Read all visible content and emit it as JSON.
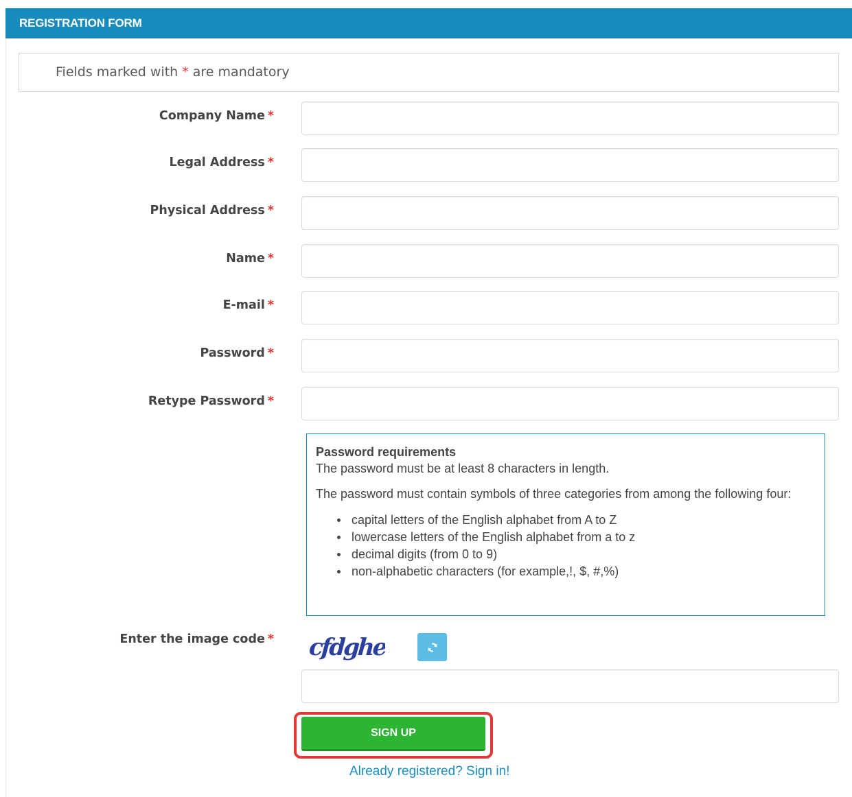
{
  "header": {
    "title": "REGISTRATION FORM"
  },
  "notice": {
    "prefix": "Fields marked with ",
    "star": "*",
    "suffix": " are mandatory"
  },
  "fields": [
    {
      "label": "Company Name",
      "value": ""
    },
    {
      "label": "Legal Address",
      "value": ""
    },
    {
      "label": "Physical Address",
      "value": ""
    },
    {
      "label": "Name",
      "value": ""
    },
    {
      "label": "E-mail",
      "value": ""
    },
    {
      "label": "Password",
      "value": ""
    },
    {
      "label": "Retype Password",
      "value": ""
    }
  ],
  "required_marker": "*",
  "password_requirements": {
    "title": "Password requirements",
    "length_rule": "The password must be at least 8 characters in length.",
    "categories_rule": "The password must contain symbols of three categories from among the following four:",
    "categories": [
      "capital letters of the English alphabet from A to Z",
      "lowercase letters of the English alphabet from a to z",
      "decimal digits (from 0 to 9)",
      "non-alphabetic characters (for example,!, $, #,%)"
    ]
  },
  "captcha": {
    "label": "Enter the image code",
    "code": "cfdghe",
    "refresh_icon": "refresh-icon",
    "value": ""
  },
  "actions": {
    "signup_label": "SIGN UP",
    "signin_link": "Already registered? Sign in!"
  },
  "colors": {
    "header_bg": "#188bbd",
    "signup_bg": "#2bb533",
    "highlight": "#e03a35",
    "required": "#e3342f",
    "link": "#1a8fc3",
    "refresh_bg": "#5bbde6"
  }
}
